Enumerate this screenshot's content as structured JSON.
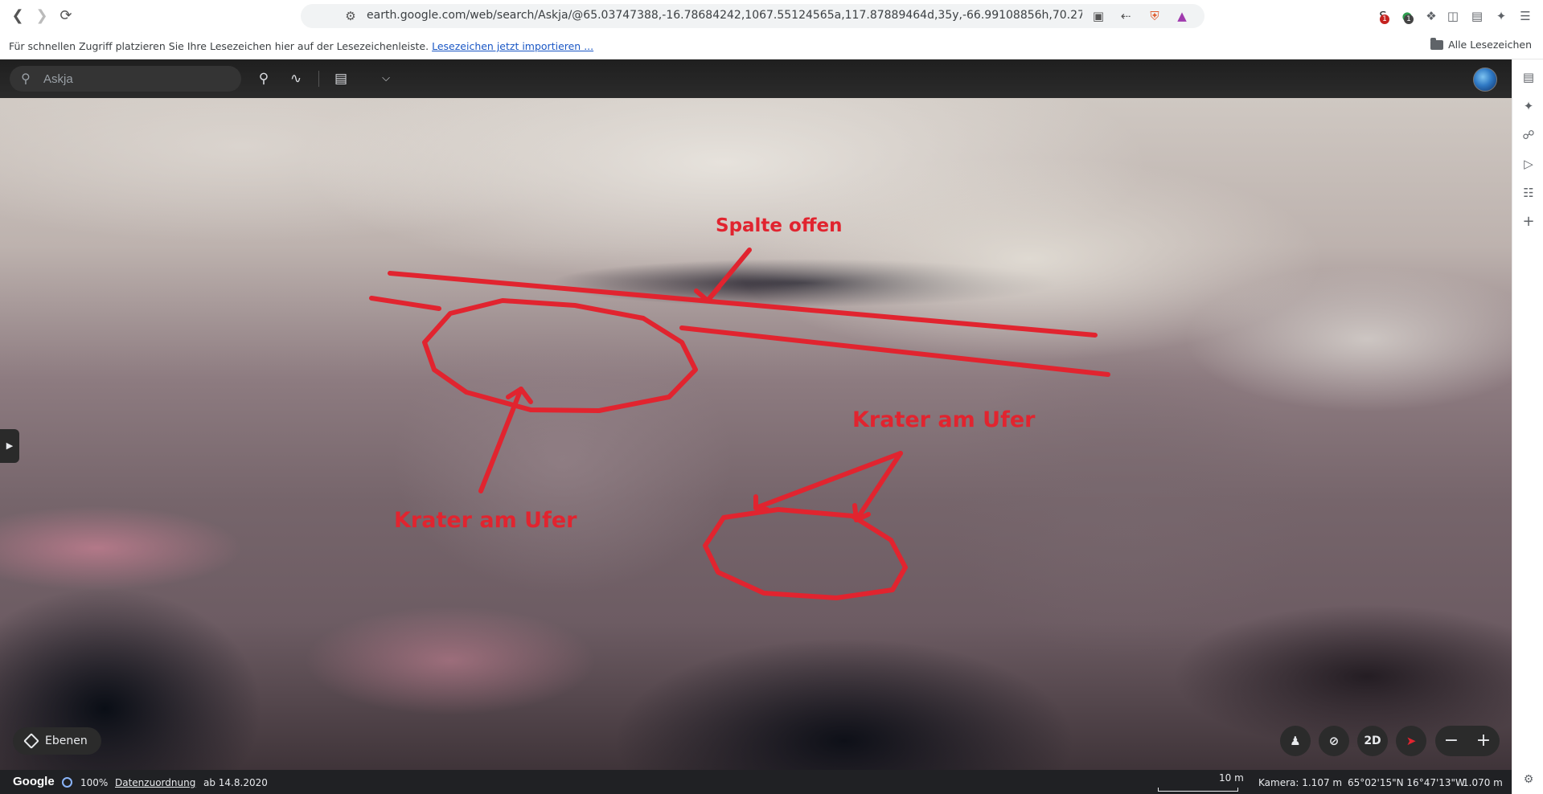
{
  "browser": {
    "url": "earth.google.com/web/search/Askja/@65.03747388,-16.78684242,1067.55124565a,117.87889464d,35y,-66.99108856h,70.27791181t,360...",
    "badges": {
      "ext1": "1",
      "ext2": "1"
    }
  },
  "bookmarks_bar": {
    "hint": "Für schnellen Zugriff platzieren Sie Ihre Lesezeichen hier auf der Lesezeichenleiste.",
    "import_link": "Lesezeichen jetzt importieren ...",
    "all_bookmarks": "Alle Lesezeichen"
  },
  "earth": {
    "search_placeholder": "Askja",
    "layers_label": "Ebenen",
    "view_2d_label": "2D",
    "annotations": {
      "crack_label": "Spalte offen",
      "crater_left_label": "Krater am Ufer",
      "crater_right_label": "Krater am Ufer",
      "color": "#e1242f"
    }
  },
  "statusbar": {
    "brand": "Google",
    "loading_percent": "100%",
    "data_attribution": "Datenzuordnung",
    "imagery_date": "ab 14.8.2020",
    "scale_label": "10 m",
    "camera": "Kamera: 1.107 m",
    "coordinates": "65°02'15\"N 16°47'13\"W",
    "elevation": "1.070 m"
  }
}
